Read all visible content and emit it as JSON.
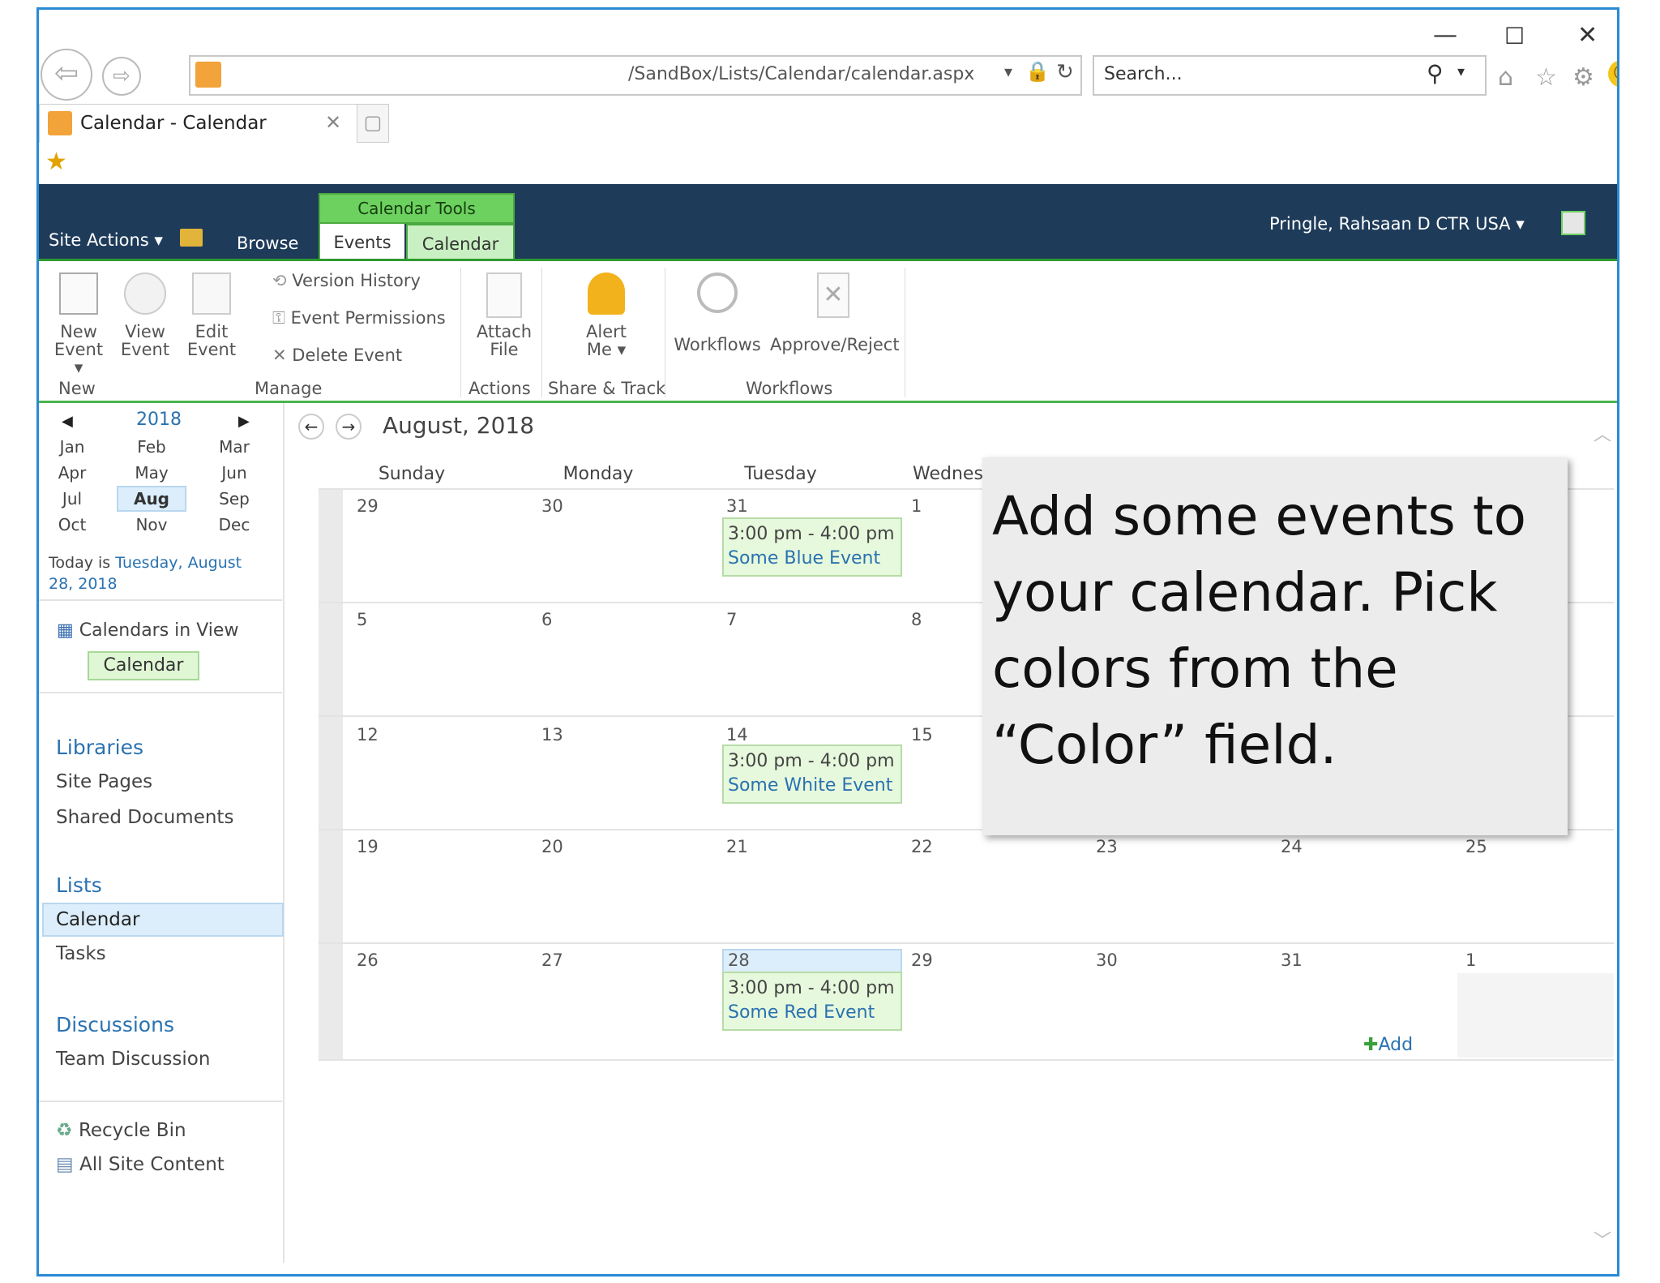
{
  "browser": {
    "address": "/SandBox/Lists/Calendar/calendar.aspx",
    "search_placeholder": "Search...",
    "tab_title": "Calendar - Calendar"
  },
  "sharepoint": {
    "site_actions": "Site Actions",
    "browse": "Browse",
    "context_group": "Calendar Tools",
    "tab_events": "Events",
    "tab_calendar": "Calendar",
    "user": "Pringle, Rahsaan D CTR USA"
  },
  "ribbon": {
    "new_event": [
      "New",
      "Event"
    ],
    "view_event": [
      "View",
      "Event"
    ],
    "edit_event": [
      "Edit",
      "Event"
    ],
    "version_history": "Version History",
    "event_permissions": "Event Permissions",
    "delete_event": "Delete Event",
    "attach_file": [
      "Attach",
      "File"
    ],
    "alert_me": [
      "Alert",
      "Me"
    ],
    "workflows": "Workflows",
    "approve_reject": "Approve/Reject",
    "groups": {
      "new": "New",
      "manage": "Manage",
      "actions": "Actions",
      "share": "Share & Track",
      "workflows": "Workflows"
    }
  },
  "picker": {
    "year": "2018",
    "months": [
      "Jan",
      "Feb",
      "Mar",
      "Apr",
      "May",
      "Jun",
      "Jul",
      "Aug",
      "Sep",
      "Oct",
      "Nov",
      "Dec"
    ],
    "today_label": "Today is ",
    "today_value": "Tuesday, August",
    "today_value2": "28, 2018"
  },
  "calendars_in_view": {
    "title": "Calendars in View",
    "item": "Calendar"
  },
  "leftnav": {
    "libraries": "Libraries",
    "site_pages": "Site Pages",
    "shared_documents": "Shared Documents",
    "lists": "Lists",
    "calendar": "Calendar",
    "tasks": "Tasks",
    "discussions": "Discussions",
    "team_discussion": "Team Discussion",
    "recycle_bin": "Recycle Bin",
    "all_site_content": "All Site Content"
  },
  "calendar": {
    "month_title": "August, 2018",
    "days": [
      "Sunday",
      "Monday",
      "Tuesday",
      "Wednes"
    ],
    "weeks": [
      [
        "29",
        "30",
        "31",
        "1"
      ],
      [
        "5",
        "6",
        "7",
        "8"
      ],
      [
        "12",
        "13",
        "14",
        "15"
      ],
      [
        "19",
        "20",
        "21",
        "22",
        "23",
        "24",
        "25"
      ],
      [
        "26",
        "27",
        "28",
        "29",
        "30",
        "31",
        "1"
      ]
    ],
    "events": [
      {
        "time": "3:00 pm - 4:00 pm",
        "name": "Some Blue Event"
      },
      {
        "time": "3:00 pm - 4:00 pm",
        "name": "Some White Event"
      },
      {
        "time": "3:00 pm - 4:00 pm",
        "name": "Some Red Event"
      }
    ],
    "add": "Add"
  },
  "callout": {
    "text": "Add some events to your calendar. Pick colors from the “Color” field."
  }
}
